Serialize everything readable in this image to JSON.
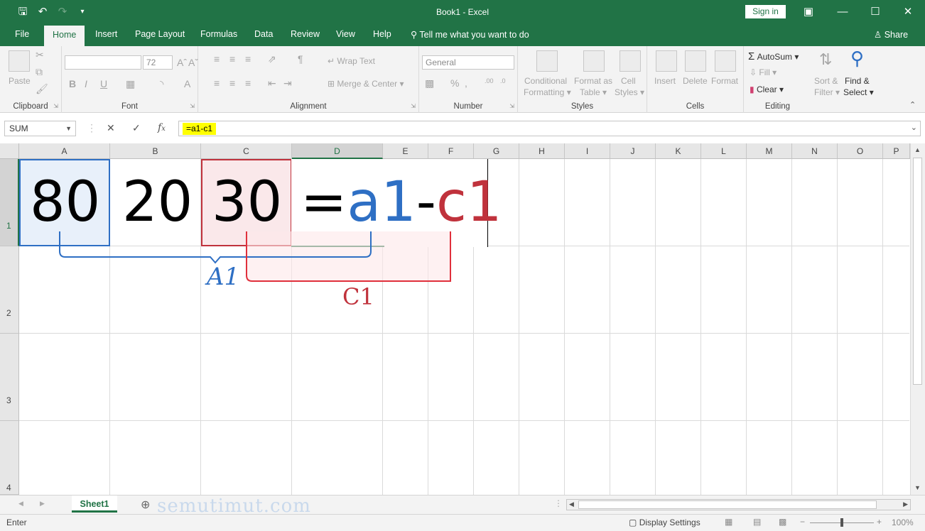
{
  "title_bar": {
    "title": "Book1  -  Excel",
    "sign_in": "Sign in"
  },
  "tabs": [
    "File",
    "Home",
    "Insert",
    "Page Layout",
    "Formulas",
    "Data",
    "Review",
    "View",
    "Help"
  ],
  "tell_me": "Tell me what you want to do",
  "share": "Share",
  "ribbon": {
    "clipboard": {
      "paste": "Paste",
      "label": "Clipboard"
    },
    "font": {
      "font_name": "",
      "font_size": "72",
      "label": "Font"
    },
    "alignment": {
      "wrap_text": "Wrap Text",
      "merge_center": "Merge & Center",
      "label": "Alignment"
    },
    "number": {
      "format": "General",
      "label": "Number"
    },
    "styles": {
      "conditional_1": "Conditional",
      "conditional_2": "Formatting",
      "format_table_1": "Format as",
      "format_table_2": "Table",
      "cell_styles_1": "Cell",
      "cell_styles_2": "Styles",
      "label": "Styles"
    },
    "cells": {
      "insert": "Insert",
      "delete": "Delete",
      "format": "Format",
      "label": "Cells"
    },
    "editing": {
      "autosum": "AutoSum",
      "fill": "Fill",
      "clear": "Clear",
      "sort_1": "Sort &",
      "sort_2": "Filter",
      "find_1": "Find &",
      "find_2": "Select",
      "label": "Editing"
    }
  },
  "formula_bar": {
    "name_box": "SUM",
    "formula": "=a1-c1"
  },
  "columns": [
    "A",
    "B",
    "C",
    "D",
    "E",
    "F",
    "G",
    "H",
    "I",
    "J",
    "K",
    "L",
    "M",
    "N",
    "O",
    "P"
  ],
  "rows": [
    "1",
    "2",
    "3",
    "4"
  ],
  "cells": {
    "A1": "80",
    "B1": "20",
    "C1": "30",
    "D1_eq": "=",
    "D1_ref1": "a1",
    "D1_minus": "-",
    "D1_ref2": "c1"
  },
  "annotations": {
    "a1_label": "A1",
    "c1_label": "C1"
  },
  "sheet_tabs": [
    "Sheet1"
  ],
  "watermark": "semutimut.com",
  "status": {
    "mode": "Enter",
    "display_settings": "Display Settings",
    "zoom": "100%"
  },
  "colors": {
    "excel_green": "#217346",
    "ref_blue": "#2e6fc4",
    "ref_red": "#c0323c",
    "highlight": "#ffff00"
  }
}
